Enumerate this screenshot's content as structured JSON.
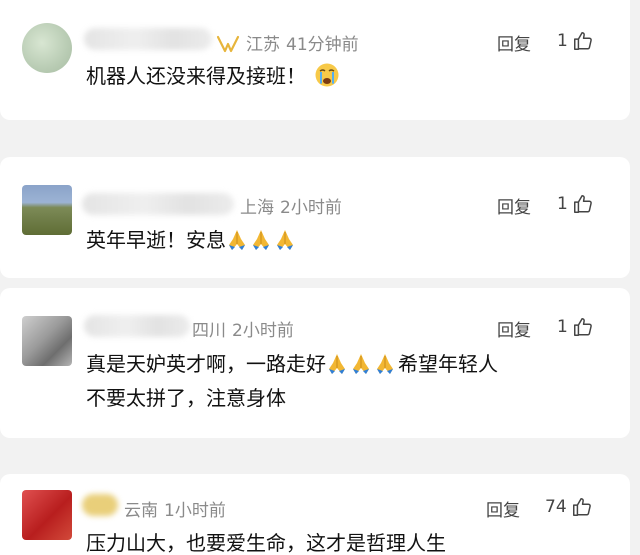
{
  "comments": [
    {
      "location": "江苏",
      "time": "41分钟前",
      "reply_label": "回复",
      "likes": "1",
      "text": "机器人还没来得及接班！",
      "emoji": "cry-face-emoji"
    },
    {
      "location": "上海",
      "time": "2小时前",
      "reply_label": "回复",
      "likes": "1",
      "text": "英年早逝！安息",
      "emoji": "pray-emoji"
    },
    {
      "location": "四川",
      "time": "2小时前",
      "reply_label": "回复",
      "likes": "1",
      "text_line1_a": "真是天妒英才啊，一路走好",
      "text_line1_b": "希望年轻人",
      "text_line2": "不要太拼了，注意身体",
      "emoji": "pray-emoji"
    },
    {
      "location": "云南",
      "time": "1小时前",
      "reply_label": "回复",
      "likes": "74",
      "text": "压力山大，也要爱生命，这才是哲理人生"
    }
  ],
  "icons": {
    "like": "thumbs-up-icon",
    "vip": "vip-wings-icon"
  },
  "colors": {
    "meta_text": "#8a8a8a",
    "vip_gold": "#e7b53c",
    "background": "#f2f2f2"
  }
}
